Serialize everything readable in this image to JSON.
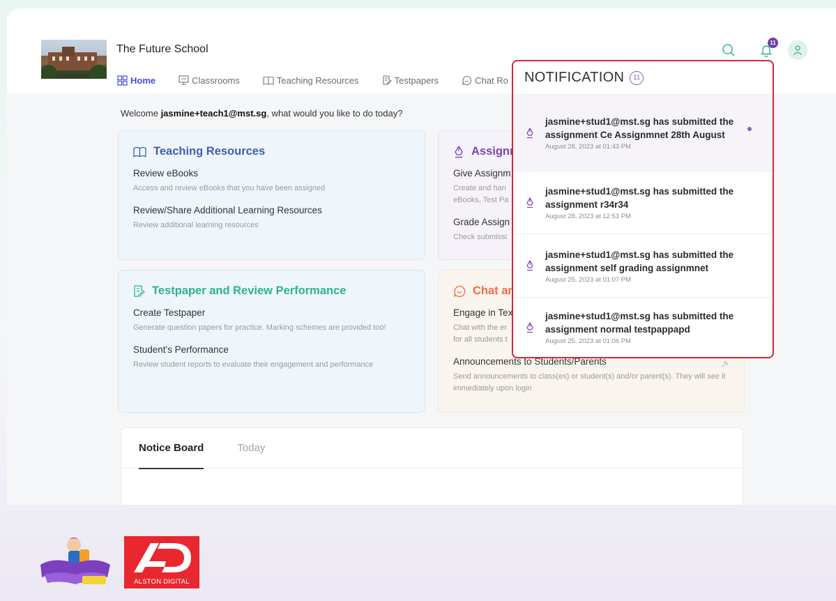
{
  "school": {
    "name": "The Future School"
  },
  "nav": {
    "home": "Home",
    "classrooms": "Classrooms",
    "teaching_resources": "Teaching Resources",
    "testpapers": "Testpapers",
    "chat": "Chat Ro"
  },
  "header": {
    "bell_count": "11"
  },
  "welcome": {
    "prefix": "Welcome ",
    "user": "jasmine+teach1@mst.sg",
    "suffix": ", what would you like to do today?"
  },
  "cards": {
    "teaching": {
      "title": "Teaching Resources",
      "items": [
        {
          "title": "Review eBooks",
          "desc": "Access and review eBooks that you have been assigned"
        },
        {
          "title": "Review/Share Additional Learning Resources",
          "desc": "Review additional learning resources"
        }
      ]
    },
    "testpaper": {
      "title": "Testpaper and Review Performance",
      "items": [
        {
          "title": "Create Testpaper",
          "desc": "Generate question papers for practice. Marking schemes are provided too!"
        },
        {
          "title": "Student's Performance",
          "desc": "Review student reports to evaluate their engagement and performance"
        }
      ]
    },
    "assignments": {
      "title": "Assignm",
      "items": [
        {
          "title": "Give Assignm",
          "desc_line1": "Create and han",
          "desc_line2": "eBooks, Test Pa"
        },
        {
          "title": "Grade Assign",
          "desc": "Check submissi"
        }
      ]
    },
    "chat": {
      "title": "Chat an",
      "items": [
        {
          "title": "Engage in Tex",
          "desc_line1": "Chat with the er",
          "desc_line2": "for all students t"
        },
        {
          "title": "Announcements to Students/Parents",
          "desc": "Send announcements to class(es) or student(s) and/or parent(s). They will see it immediately upon login"
        }
      ]
    }
  },
  "notice_board": {
    "tab_active": "Notice Board",
    "tab_other": "Today"
  },
  "notifications": {
    "title": "NOTIFICATION",
    "count": "11",
    "items": [
      {
        "message": "jasmine+stud1@mst.sg has submitted the assignment Ce Assignmnet 28th August",
        "date": "August 28, 2023 at 01:43 PM",
        "unread": true
      },
      {
        "message": "jasmine+stud1@mst.sg has submitted the assignment r34r34",
        "date": "August 28, 2023 at 12:53 PM",
        "unread": false
      },
      {
        "message": "jasmine+stud1@mst.sg has submitted the assignment self grading assignmnet",
        "date": "August 25, 2023 at 01:07 PM",
        "unread": false
      },
      {
        "message": "jasmine+stud1@mst.sg has submitted the assignment normal testpappapd",
        "date": "August 25, 2023 at 01:06 PM",
        "unread": false
      }
    ]
  },
  "footer": {
    "alston_digital_label": "ALSTON DIGITAL"
  },
  "colors": {
    "nav_active": "#4a4bd6",
    "teaching": "#3e5fb4",
    "testpaper": "#2fb38a",
    "assignments": "#7a46b2",
    "chat": "#ee6d45",
    "highlight_border": "#d2283a",
    "badge": "#6f3fa6"
  }
}
